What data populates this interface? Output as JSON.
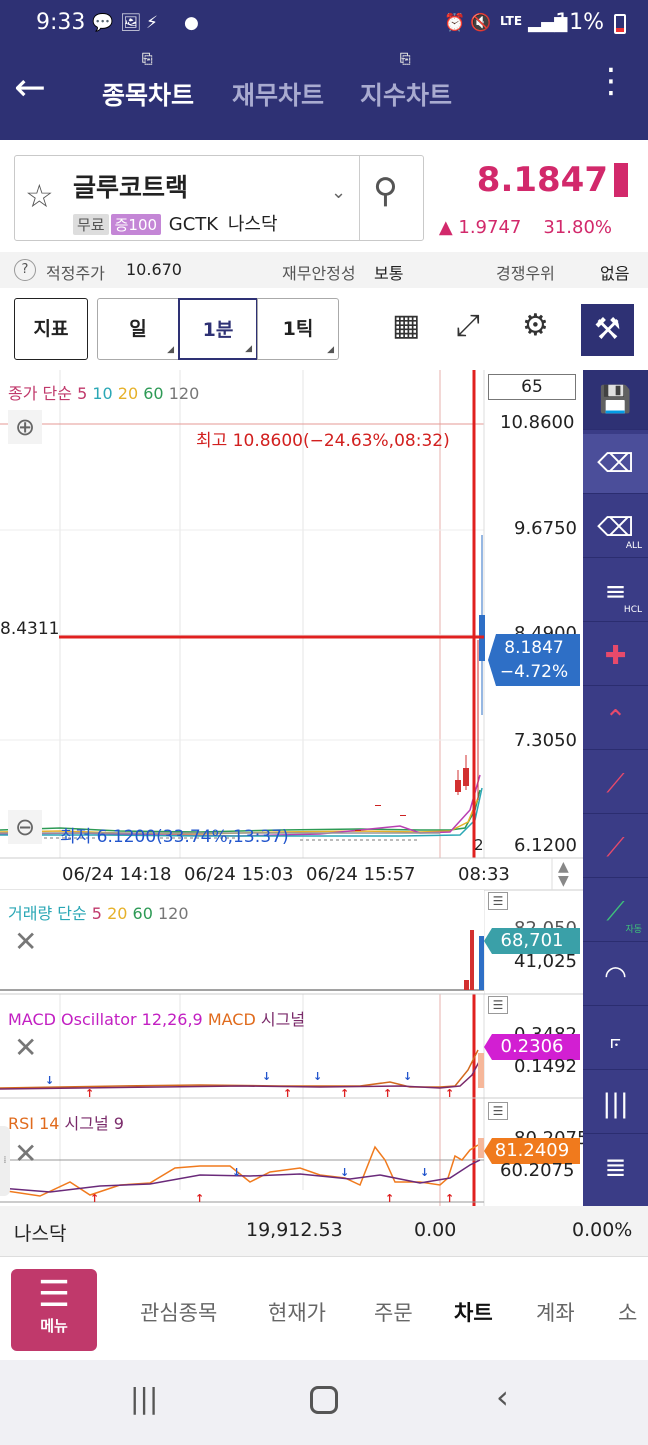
{
  "status": {
    "time": "9:33",
    "battery": "11%",
    "lte": "LTE"
  },
  "header": {
    "tabs": [
      {
        "label": "종목차트",
        "active": true
      },
      {
        "label": "재무차트",
        "active": false
      },
      {
        "label": "지수차트",
        "active": false
      }
    ]
  },
  "stock": {
    "name": "글루코트랙",
    "tags": [
      "무료",
      "증100"
    ],
    "ticker": "GCTK",
    "market": "나스닥",
    "price": "8.1847",
    "change": "▲ 1.9747",
    "change_pct": "31.80%"
  },
  "info": {
    "fair_label": "적정주가",
    "fair_value": "10.670",
    "fin_label": "재무안정성",
    "fin_value": "보통",
    "comp_label": "경쟁우위",
    "comp_value": "없음"
  },
  "toolbar": {
    "indicator": "지표",
    "day": "일",
    "min1": "1분",
    "tick1": "1틱"
  },
  "chart": {
    "price_legend": "종가 단순",
    "ma": [
      "5",
      "10",
      "20",
      "60",
      "120"
    ],
    "count": "65",
    "high_label": "최고 10.8600(−24.63%,08:32)",
    "low_label": "최저 6.1200(33.74%,13:37)",
    "y_ticks": [
      "10.8600",
      "9.6750",
      "8.4900",
      "7.3050",
      "6.1200"
    ],
    "cursor_price": "8.4311",
    "current_price": "8.1847",
    "current_pct": "−4.72%",
    "x_ticks": [
      "06/24 14:18",
      "06/24 15:03",
      "06/24 15:57",
      "08:33"
    ],
    "page_num": "2",
    "volume_legend": "거래량 단순",
    "vol_ma": [
      "5",
      "20",
      "60",
      "120"
    ],
    "vol_ticks": [
      "82,050",
      "41,025"
    ],
    "vol_current": "68,701",
    "macd_legend_a": "MACD Oscillator 12,26,9",
    "macd_legend_b": "MACD",
    "macd_legend_c": "시그널",
    "macd_ticks": [
      "0.3482",
      "0.1492"
    ],
    "macd_current": "0.2306",
    "rsi_legend_a": "RSI 14",
    "rsi_legend_b": "시그널 9",
    "rsi_ticks": [
      "80.2075",
      "60.2075"
    ],
    "rsi_current": "81.2409"
  },
  "colors": {
    "brand": "#2e3174",
    "up": "#d2296b",
    "price_tag": "#2e6fc6",
    "macd_tag": "#d21fd2",
    "rsi_tag": "#f07a1d",
    "vol_tag": "#3aa0a8",
    "cursor": "#e0201f"
  },
  "sidebar": {
    "icons": [
      "save-icon",
      "erase-icon",
      "erase-all-icon",
      "hcl-line-icon",
      "crosshair-icon",
      "trend-peak-icon",
      "zigzag-icon",
      "trendline-icon",
      "auto-trend-icon",
      "arc-icon",
      "fan-icon",
      "grid-lines-icon",
      "fibonacci-icon"
    ],
    "all_label": "ALL",
    "auto_label": "자동",
    "hcl": "HCL"
  },
  "index_bar": {
    "name": "나스닥",
    "value": "19,912.53",
    "change": "0.00",
    "pct": "0.00%"
  },
  "bottom_nav": {
    "menu": "메뉴",
    "items": [
      "관심종목",
      "현재가",
      "주문",
      "차트",
      "계좌",
      "소"
    ],
    "active": "차트"
  }
}
